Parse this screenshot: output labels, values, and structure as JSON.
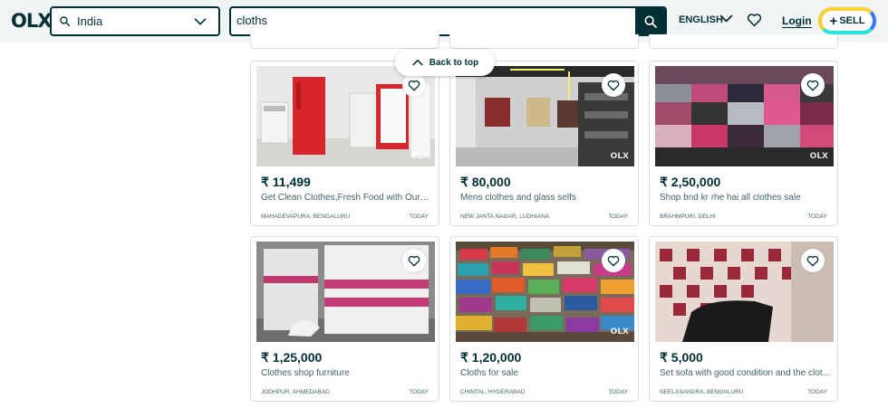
{
  "header": {
    "logo": "OLX",
    "location": "India",
    "search_value": "cloths",
    "language": "ENGLISH",
    "login": "Login",
    "sell": "SELL"
  },
  "back_to_top": "Back to top",
  "listings": [
    {
      "price": "₹ 11,499",
      "title": "Get Clean Clothes,Fresh Food with Our Re...",
      "location": "MAHADEVAPURA, BENGALURU",
      "date": "TODAY"
    },
    {
      "price": "₹ 80,000",
      "title": "Mens clothes and glass selfs",
      "location": "NEW JANTA NAGAR, LUDHIANA",
      "date": "TODAY"
    },
    {
      "price": "₹ 2,50,000",
      "title": "Shop bnd kr rhe hai all clothes sale",
      "location": "BRAHMPURI, DELHI",
      "date": "TODAY"
    },
    {
      "price": "₹ 1,25,000",
      "title": "Clothes shop furniture",
      "location": "JODHPUR, AHMEDABAD",
      "date": "TODAY"
    },
    {
      "price": "₹ 1,20,000",
      "title": "Cloths for sale",
      "location": "CHINTAL, HYDERABAD",
      "date": "TODAY"
    },
    {
      "price": "₹ 5,000",
      "title": "Set sofa with good condition and the clot...",
      "location": "NEELASANDRA, BENGALURU",
      "date": "TODAY"
    }
  ],
  "icons": {
    "search": "search-icon",
    "chevron": "chevron-down-icon",
    "heart": "heart-icon",
    "up": "chevron-up-icon"
  }
}
